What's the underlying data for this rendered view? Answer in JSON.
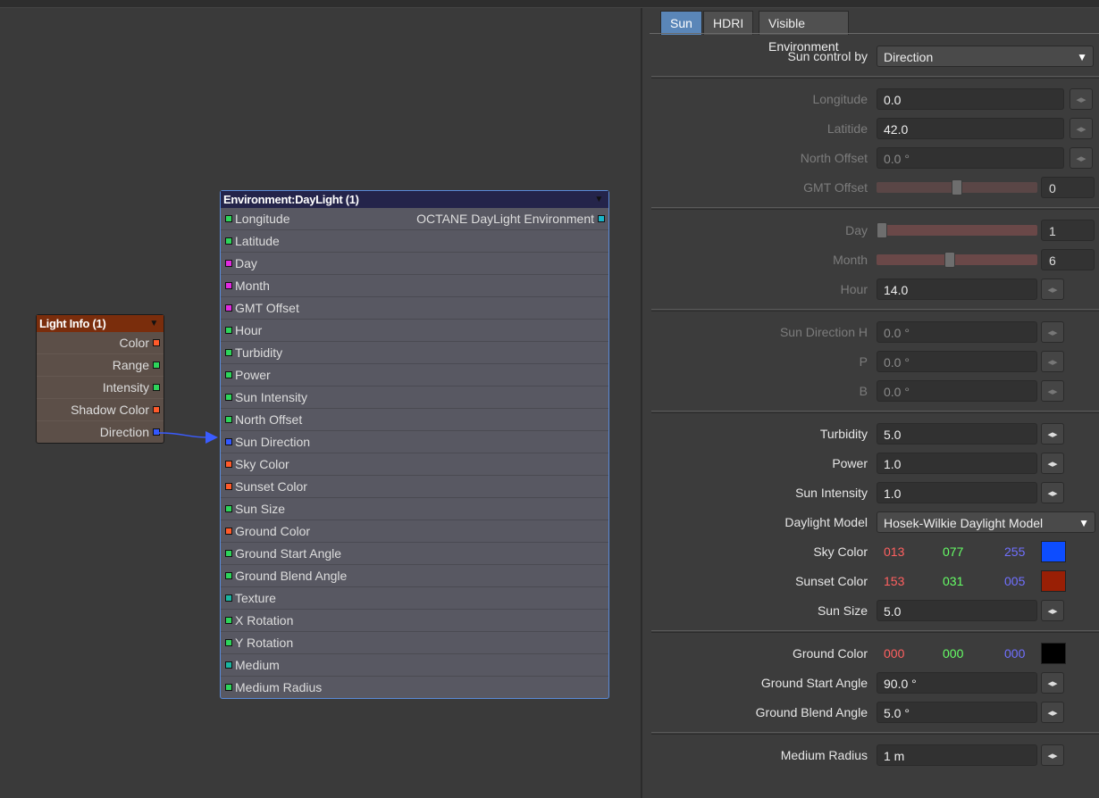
{
  "light_node": {
    "title": "Light Info (1)",
    "outputs": [
      {
        "label": "Color",
        "color": "#ff5a2a"
      },
      {
        "label": "Range",
        "color": "#2dd45a"
      },
      {
        "label": "Intensity",
        "color": "#2dd45a"
      },
      {
        "label": "Shadow Color",
        "color": "#ff5a2a"
      },
      {
        "label": "Direction",
        "color": "#3358ff"
      }
    ]
  },
  "daylight_node": {
    "title": "Environment:DayLight (1)",
    "output_label": "OCTANE DayLight Environment",
    "inputs": [
      {
        "label": "Longitude",
        "color": "#2dd45a"
      },
      {
        "label": "Latitude",
        "color": "#2dd45a"
      },
      {
        "label": "Day",
        "color": "#e02ae0"
      },
      {
        "label": "Month",
        "color": "#e02ae0"
      },
      {
        "label": "GMT Offset",
        "color": "#e02ae0"
      },
      {
        "label": "Hour",
        "color": "#2dd45a"
      },
      {
        "label": "Turbidity",
        "color": "#2dd45a"
      },
      {
        "label": "Power",
        "color": "#2dd45a"
      },
      {
        "label": "Sun Intensity",
        "color": "#2dd45a"
      },
      {
        "label": "North Offset",
        "color": "#2dd45a"
      },
      {
        "label": "Sun Direction",
        "color": "#3358ff"
      },
      {
        "label": "Sky Color",
        "color": "#ff5a2a"
      },
      {
        "label": "Sunset Color",
        "color": "#ff5a2a"
      },
      {
        "label": "Sun Size",
        "color": "#2dd45a"
      },
      {
        "label": "Ground Color",
        "color": "#ff5a2a"
      },
      {
        "label": "Ground Start Angle",
        "color": "#2dd45a"
      },
      {
        "label": "Ground Blend Angle",
        "color": "#2dd45a"
      },
      {
        "label": "Texture",
        "color": "#1ab4a0"
      },
      {
        "label": "X Rotation",
        "color": "#2dd45a"
      },
      {
        "label": "Y Rotation",
        "color": "#2dd45a"
      },
      {
        "label": "Medium",
        "color": "#1ab4a0"
      },
      {
        "label": "Medium Radius",
        "color": "#2dd45a"
      }
    ]
  },
  "tabs": [
    "Sun",
    "HDRI",
    "Visible Environment"
  ],
  "panel": {
    "sun_control_label": "Sun control by",
    "sun_control_value": "Direction",
    "longitude_label": "Longitude",
    "longitude_value": "0.0",
    "latitude_label": "Latitide",
    "latitude_value": "42.0",
    "north_offset_label": "North Offset",
    "north_offset_value": "0.0 °",
    "gmt_offset_label": "GMT Offset",
    "gmt_offset_value": "0",
    "gmt_offset_fraction": 0.5,
    "day_label": "Day",
    "day_value": "1",
    "day_fraction": 0.0,
    "month_label": "Month",
    "month_value": "6",
    "month_fraction": 0.45,
    "hour_label": "Hour",
    "hour_value": "14.0",
    "sun_dir_h_label": "Sun Direction H",
    "sun_dir_h_value": "0.0 °",
    "sun_dir_p_label": "P",
    "sun_dir_p_value": "0.0 °",
    "sun_dir_b_label": "B",
    "sun_dir_b_value": "0.0 °",
    "turbidity_label": "Turbidity",
    "turbidity_value": "5.0",
    "power_label": "Power",
    "power_value": "1.0",
    "sun_intensity_label": "Sun Intensity",
    "sun_intensity_value": "1.0",
    "daylight_model_label": "Daylight Model",
    "daylight_model_value": "Hosek-Wilkie Daylight Model",
    "sky_color_label": "Sky Color",
    "sky_r": "013",
    "sky_g": "077",
    "sky_b": "255",
    "sky_swatch": "#0d4dff",
    "sunset_color_label": "Sunset Color",
    "sunset_r": "153",
    "sunset_g": "031",
    "sunset_b": "005",
    "sunset_swatch": "#991f05",
    "sun_size_label": "Sun Size",
    "sun_size_value": "5.0",
    "ground_color_label": "Ground Color",
    "ground_r": "000",
    "ground_g": "000",
    "ground_b": "000",
    "ground_swatch": "#000000",
    "ground_start_label": "Ground Start Angle",
    "ground_start_value": "90.0 °",
    "ground_blend_label": "Ground Blend Angle",
    "ground_blend_value": "5.0 °",
    "medium_radius_label": "Medium Radius",
    "medium_radius_value": "1 m"
  }
}
